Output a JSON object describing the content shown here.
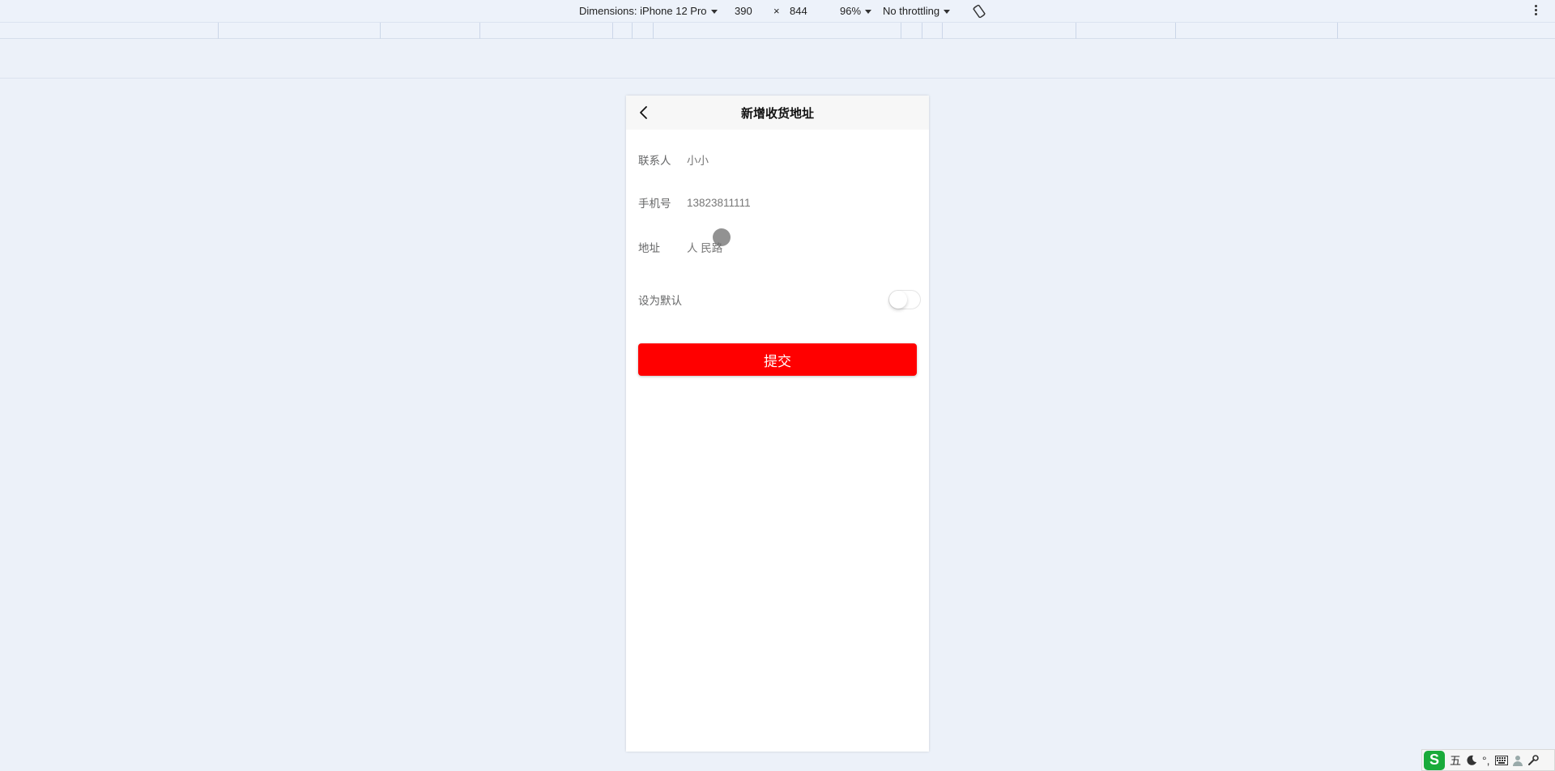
{
  "devtools": {
    "device_label": "Dimensions: iPhone 12 Pro",
    "width": "390",
    "times": "×",
    "height": "844",
    "zoom": "96%",
    "throttling": "No throttling"
  },
  "nav": {
    "title": "新增收货地址",
    "back_icon": "chevron-left-icon"
  },
  "form": {
    "contact": {
      "label": "联系人",
      "value": "小小"
    },
    "phone": {
      "label": "手机号",
      "value": "13823811111"
    },
    "address": {
      "label": "地址",
      "value": "人 民路"
    },
    "default": {
      "label": "设为默认",
      "enabled": false
    }
  },
  "submit_label": "提交",
  "ime": {
    "logo": "S",
    "mode": "五",
    "icons": [
      "moon-icon",
      "punctuation-icon",
      "keyboard-icon",
      "user-icon",
      "wrench-icon"
    ],
    "punctuation": "°,"
  },
  "colors": {
    "accent": "#ff0000",
    "page_background": "#ecf1f9",
    "nav_background": "#f7f7f7"
  }
}
